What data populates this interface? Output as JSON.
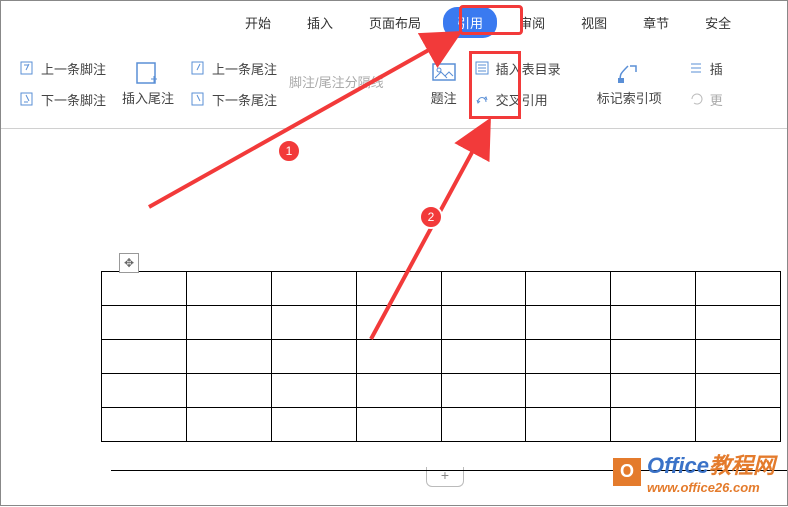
{
  "tabs": {
    "start": "开始",
    "insert": "插入",
    "layout": "页面布局",
    "reference": "引用",
    "review": "审阅",
    "view": "视图",
    "chapter": "章节",
    "security": "安全"
  },
  "ribbon": {
    "prev_footnote": "上一条脚注",
    "next_footnote": "下一条脚注",
    "insert_endnote": "插入尾注",
    "prev_endnote": "上一条尾注",
    "next_endnote": "下一条尾注",
    "separator": "脚注/尾注分隔线",
    "caption": "题注",
    "insert_toc": "插入表目录",
    "cross_reference": "交叉引用",
    "mark_index": "标记索引项",
    "ins": "插",
    "update": "更"
  },
  "badges": {
    "one": "1",
    "two": "2"
  },
  "watermark": {
    "brand": "Office",
    "brand_cn": "教程网",
    "url": "www.office26.com",
    "logo": "O"
  }
}
